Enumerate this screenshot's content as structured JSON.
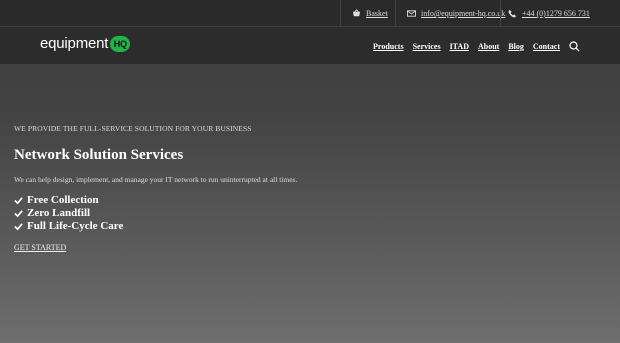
{
  "topbar": {
    "basket_label": "Basket",
    "email_label": "info@equipment-hq.co.uk",
    "phone_label": "+44 (0)1279 656 731"
  },
  "header": {
    "logo_text": "equipment",
    "logo_badge": "HQ",
    "nav": [
      "Products",
      "Services",
      "ITAD",
      "About",
      "Blog",
      "Contact"
    ]
  },
  "hero": {
    "eyebrow": "WE PROVIDE THE FULL-SERVICE SOLUTION FOR YOUR BUSINESS",
    "title": "Network Solution Services",
    "lead": "We can help design, implement, and manage your IT network to run uninterrupted at all times.",
    "features": [
      "Free Collection",
      "Zero Landfill",
      "Full Life-Cycle Care"
    ],
    "cta": "GET STARTED"
  },
  "colors": {
    "brand_green": "#1fb34a",
    "topbar_bg": "#2a2a2a"
  },
  "icons": [
    "basket-icon",
    "email-icon",
    "phone-icon",
    "search-icon",
    "check-icon"
  ]
}
